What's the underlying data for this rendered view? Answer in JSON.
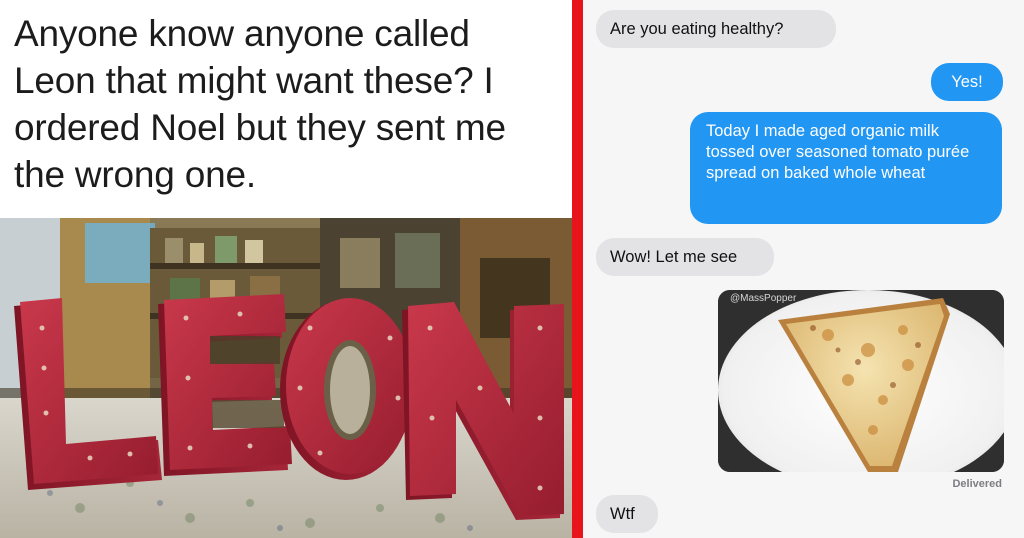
{
  "left": {
    "caption_lines": [
      "Anyone know anyone called",
      "Leon that might want these? I",
      "ordered Noel but they sent me",
      "the wrong one."
    ],
    "sign_letters": [
      "L",
      "E",
      "O",
      "N"
    ]
  },
  "right": {
    "messages": [
      {
        "from": "them",
        "text": "Are you eating healthy?"
      },
      {
        "from": "me",
        "text": "Yes!"
      },
      {
        "from": "me",
        "text": "Today I made aged organic milk tossed over seasoned tomato purée spread on baked whole wheat"
      },
      {
        "from": "them",
        "text": "Wow! Let me see"
      },
      {
        "from": "them",
        "text": "Wtf"
      }
    ],
    "image_watermark": "@MassPopper",
    "delivered_label": "Delivered"
  },
  "colors": {
    "divider": "#e8141c",
    "outgoing_bubble": "#2196f3",
    "incoming_bubble": "#e3e3e6",
    "sign_red": "#b8283a"
  }
}
